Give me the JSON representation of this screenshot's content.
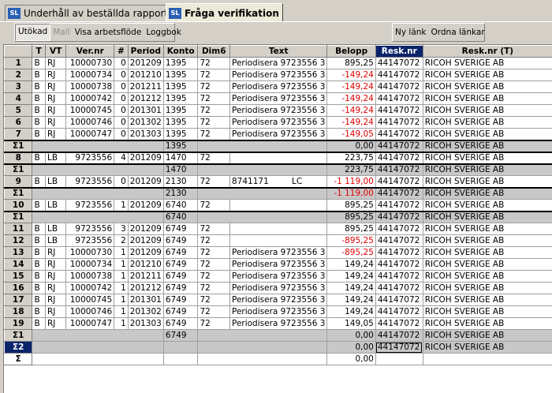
{
  "tabs": [
    {
      "label": "Underhåll av beställda rapporter",
      "active": false
    },
    {
      "label": "Fråga verifikation",
      "active": true
    }
  ],
  "tab_badge": "SL",
  "toolbar": {
    "left": [
      {
        "label": "Utökad",
        "pressed": true,
        "disabled": false
      },
      {
        "label": "Mall",
        "pressed": false,
        "disabled": true
      },
      {
        "label": "Visa arbetsflöde",
        "pressed": false,
        "disabled": false
      },
      {
        "label": "Loggbok",
        "pressed": false,
        "disabled": false
      }
    ],
    "right": [
      {
        "label": "Ny länk",
        "pressed": false,
        "disabled": false
      },
      {
        "label": "Ordna länkar",
        "pressed": false,
        "disabled": false
      }
    ]
  },
  "columns": [
    "",
    "T",
    "VT",
    "Ver.nr",
    "#",
    "Period",
    "Konto",
    "Dim6",
    "Text",
    "Belopp",
    "Resk.nr",
    "Resk.nr (T)"
  ],
  "selected_column": "Resk.nr",
  "rows": [
    {
      "kind": "data",
      "h": "1",
      "T": "B",
      "VT": "RJ",
      "ver": "10000730",
      "n": "0",
      "period": "201209",
      "konto": "1395",
      "dim6": "72",
      "text": "Periodisera 9723556 3",
      "text2": "",
      "belopp": "895,25",
      "neg": false,
      "resk": "44147072",
      "reskt": "RICOH SVERIGE AB"
    },
    {
      "kind": "data",
      "h": "2",
      "T": "B",
      "VT": "RJ",
      "ver": "10000734",
      "n": "0",
      "period": "201210",
      "konto": "1395",
      "dim6": "72",
      "text": "Periodisera 9723556 3",
      "text2": "",
      "belopp": "-149,24",
      "neg": true,
      "resk": "44147072",
      "reskt": "RICOH SVERIGE AB"
    },
    {
      "kind": "data",
      "h": "3",
      "T": "B",
      "VT": "RJ",
      "ver": "10000738",
      "n": "0",
      "period": "201211",
      "konto": "1395",
      "dim6": "72",
      "text": "Periodisera 9723556 3",
      "text2": "",
      "belopp": "-149,24",
      "neg": true,
      "resk": "44147072",
      "reskt": "RICOH SVERIGE AB"
    },
    {
      "kind": "data",
      "h": "4",
      "T": "B",
      "VT": "RJ",
      "ver": "10000742",
      "n": "0",
      "period": "201212",
      "konto": "1395",
      "dim6": "72",
      "text": "Periodisera 9723556 3",
      "text2": "",
      "belopp": "-149,24",
      "neg": true,
      "resk": "44147072",
      "reskt": "RICOH SVERIGE AB"
    },
    {
      "kind": "data",
      "h": "5",
      "T": "B",
      "VT": "RJ",
      "ver": "10000745",
      "n": "0",
      "period": "201301",
      "konto": "1395",
      "dim6": "72",
      "text": "Periodisera 9723556 3",
      "text2": "",
      "belopp": "-149,24",
      "neg": true,
      "resk": "44147072",
      "reskt": "RICOH SVERIGE AB"
    },
    {
      "kind": "data",
      "h": "6",
      "T": "B",
      "VT": "RJ",
      "ver": "10000746",
      "n": "0",
      "period": "201302",
      "konto": "1395",
      "dim6": "72",
      "text": "Periodisera 9723556 3",
      "text2": "",
      "belopp": "-149,24",
      "neg": true,
      "resk": "44147072",
      "reskt": "RICOH SVERIGE AB"
    },
    {
      "kind": "data",
      "h": "7",
      "T": "B",
      "VT": "RJ",
      "ver": "10000747",
      "n": "0",
      "period": "201303",
      "konto": "1395",
      "dim6": "72",
      "text": "Periodisera 9723556 3",
      "text2": "",
      "belopp": "-149,05",
      "neg": true,
      "resk": "44147072",
      "reskt": "RICOH SVERIGE AB"
    },
    {
      "kind": "sum",
      "h": "Σ1",
      "konto": "1395",
      "belopp": "0,00",
      "neg": false,
      "resk": "44147072",
      "reskt": "RICOH SVERIGE AB"
    },
    {
      "kind": "data",
      "h": "8",
      "T": "B",
      "VT": "LB",
      "ver": "9723556",
      "n": "4",
      "period": "201209",
      "konto": "1470",
      "dim6": "72",
      "text": "",
      "text2": "",
      "belopp": "223,75",
      "neg": false,
      "resk": "44147072",
      "reskt": "RICOH SVERIGE AB"
    },
    {
      "kind": "sum",
      "h": "Σ1",
      "konto": "1470",
      "belopp": "223,75",
      "neg": false,
      "resk": "44147072",
      "reskt": "RICOH SVERIGE AB"
    },
    {
      "kind": "data",
      "h": "9",
      "T": "B",
      "VT": "LB",
      "ver": "9723556",
      "n": "0",
      "period": "201209",
      "konto": "2130",
      "dim6": "72",
      "text": "8741171",
      "text2": "LC",
      "belopp": "-1 119,00",
      "neg": true,
      "resk": "44147072",
      "reskt": "RICOH SVERIGE AB"
    },
    {
      "kind": "sum",
      "h": "Σ1",
      "konto": "2130",
      "belopp": "-1 119,00",
      "neg": true,
      "resk": "44147072",
      "reskt": "RICOH SVERIGE AB"
    },
    {
      "kind": "data",
      "h": "10",
      "T": "B",
      "VT": "LB",
      "ver": "9723556",
      "n": "1",
      "period": "201209",
      "konto": "6740",
      "dim6": "72",
      "text": "",
      "text2": "",
      "belopp": "895,25",
      "neg": false,
      "resk": "44147072",
      "reskt": "RICOH SVERIGE AB"
    },
    {
      "kind": "sum",
      "h": "Σ1",
      "konto": "6740",
      "belopp": "895,25",
      "neg": false,
      "resk": "44147072",
      "reskt": "RICOH SVERIGE AB"
    },
    {
      "kind": "data",
      "h": "11",
      "T": "B",
      "VT": "LB",
      "ver": "9723556",
      "n": "3",
      "period": "201209",
      "konto": "6749",
      "dim6": "72",
      "text": "",
      "text2": "",
      "belopp": "895,25",
      "neg": false,
      "resk": "44147072",
      "reskt": "RICOH SVERIGE AB"
    },
    {
      "kind": "data",
      "h": "12",
      "T": "B",
      "VT": "LB",
      "ver": "9723556",
      "n": "2",
      "period": "201209",
      "konto": "6749",
      "dim6": "72",
      "text": "",
      "text2": "",
      "belopp": "-895,25",
      "neg": true,
      "resk": "44147072",
      "reskt": "RICOH SVERIGE AB"
    },
    {
      "kind": "data",
      "h": "13",
      "T": "B",
      "VT": "RJ",
      "ver": "10000730",
      "n": "1",
      "period": "201209",
      "konto": "6749",
      "dim6": "72",
      "text": "Periodisera 9723556 3",
      "text2": "",
      "belopp": "-895,25",
      "neg": true,
      "resk": "44147072",
      "reskt": "RICOH SVERIGE AB"
    },
    {
      "kind": "data",
      "h": "14",
      "T": "B",
      "VT": "RJ",
      "ver": "10000734",
      "n": "1",
      "period": "201210",
      "konto": "6749",
      "dim6": "72",
      "text": "Periodisera 9723556 3",
      "text2": "",
      "belopp": "149,24",
      "neg": false,
      "resk": "44147072",
      "reskt": "RICOH SVERIGE AB"
    },
    {
      "kind": "data",
      "h": "15",
      "T": "B",
      "VT": "RJ",
      "ver": "10000738",
      "n": "1",
      "period": "201211",
      "konto": "6749",
      "dim6": "72",
      "text": "Periodisera 9723556 3",
      "text2": "",
      "belopp": "149,24",
      "neg": false,
      "resk": "44147072",
      "reskt": "RICOH SVERIGE AB"
    },
    {
      "kind": "data",
      "h": "16",
      "T": "B",
      "VT": "RJ",
      "ver": "10000742",
      "n": "1",
      "period": "201212",
      "konto": "6749",
      "dim6": "72",
      "text": "Periodisera 9723556 3",
      "text2": "",
      "belopp": "149,24",
      "neg": false,
      "resk": "44147072",
      "reskt": "RICOH SVERIGE AB"
    },
    {
      "kind": "data",
      "h": "17",
      "T": "B",
      "VT": "RJ",
      "ver": "10000745",
      "n": "1",
      "period": "201301",
      "konto": "6749",
      "dim6": "72",
      "text": "Periodisera 9723556 3",
      "text2": "",
      "belopp": "149,24",
      "neg": false,
      "resk": "44147072",
      "reskt": "RICOH SVERIGE AB"
    },
    {
      "kind": "data",
      "h": "18",
      "T": "B",
      "VT": "RJ",
      "ver": "10000746",
      "n": "1",
      "period": "201302",
      "konto": "6749",
      "dim6": "72",
      "text": "Periodisera 9723556 3",
      "text2": "",
      "belopp": "149,24",
      "neg": false,
      "resk": "44147072",
      "reskt": "RICOH SVERIGE AB"
    },
    {
      "kind": "data",
      "h": "19",
      "T": "B",
      "VT": "RJ",
      "ver": "10000747",
      "n": "1",
      "period": "201303",
      "konto": "6749",
      "dim6": "72",
      "text": "Periodisera 9723556 3",
      "text2": "",
      "belopp": "149,05",
      "neg": false,
      "resk": "44147072",
      "reskt": "RICOH SVERIGE AB"
    },
    {
      "kind": "sum",
      "h": "Σ1",
      "konto": "6749",
      "belopp": "0,00",
      "neg": false,
      "resk": "44147072",
      "reskt": "RICOH SVERIGE AB"
    },
    {
      "kind": "sum2",
      "h": "Σ2",
      "konto": "",
      "belopp": "0,00",
      "neg": false,
      "resk": "44147072",
      "reskt": "RICOH SVERIGE AB"
    },
    {
      "kind": "sumall",
      "h": "Σ",
      "konto": "",
      "belopp": "0,00",
      "neg": false,
      "resk": "",
      "reskt": ""
    }
  ]
}
